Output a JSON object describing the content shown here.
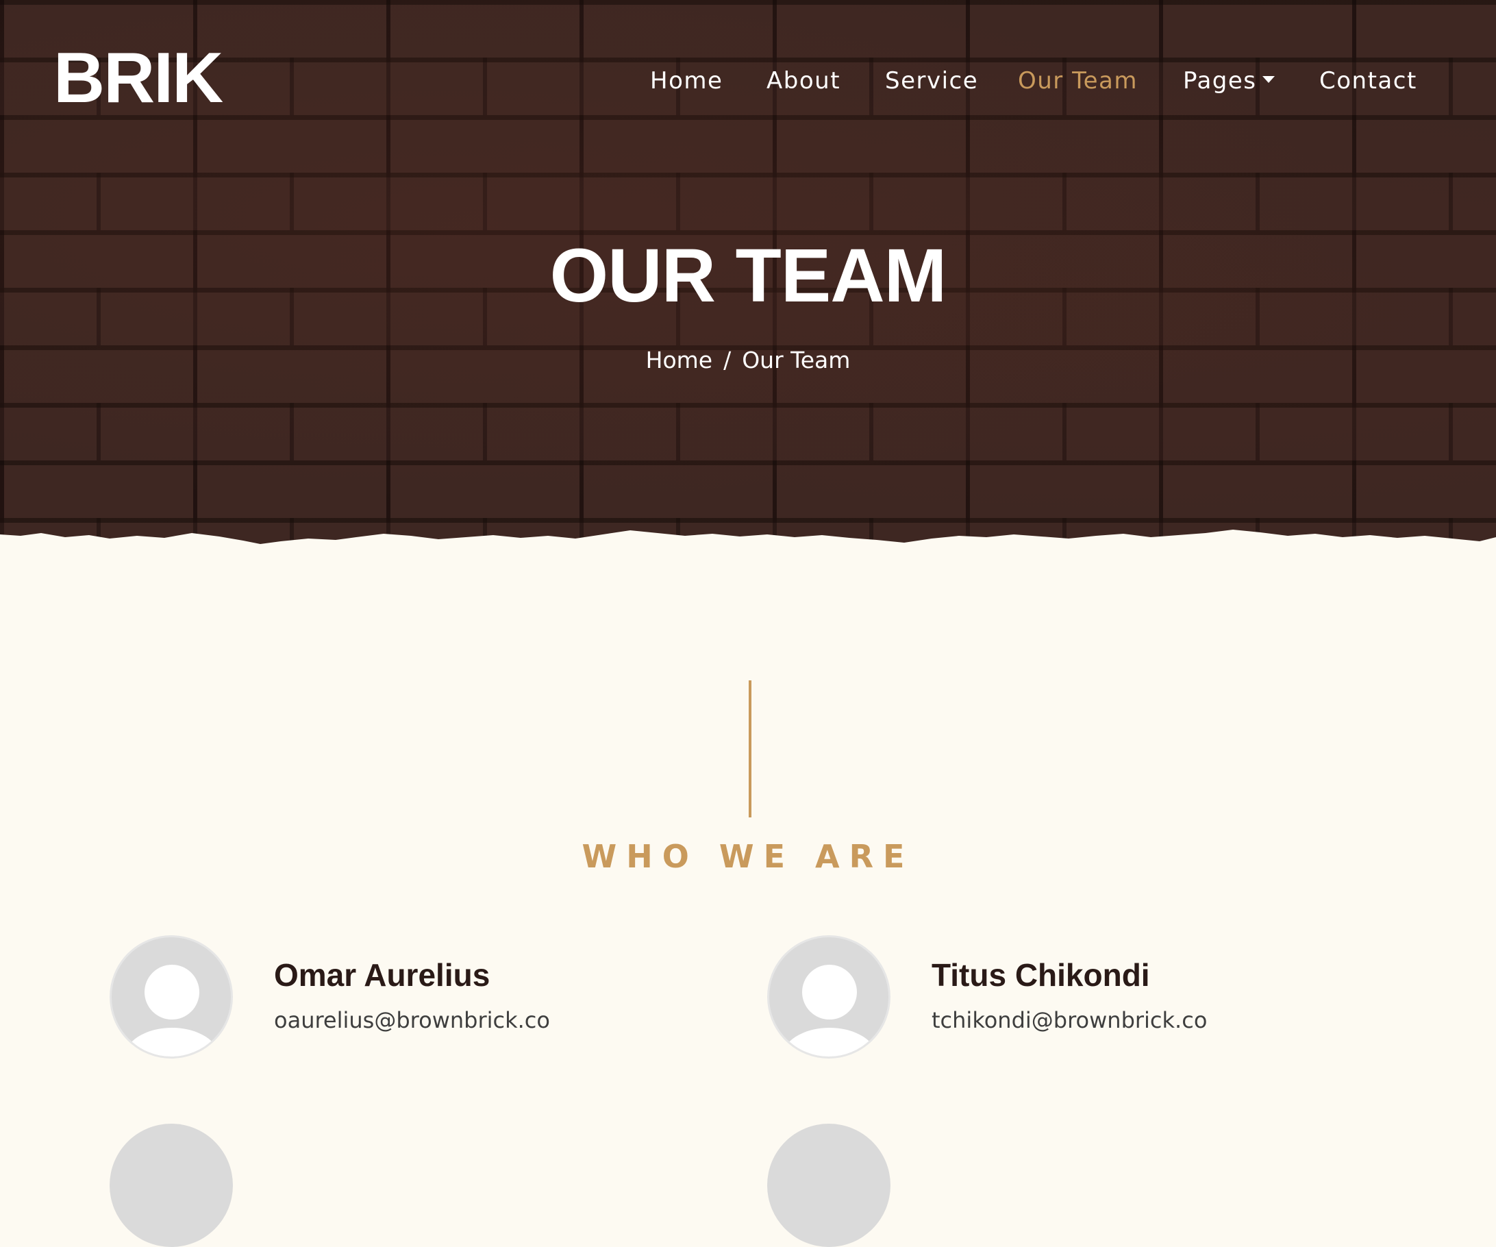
{
  "brand": {
    "logo": "BRIK"
  },
  "nav": {
    "items": [
      {
        "label": "Home"
      },
      {
        "label": "About"
      },
      {
        "label": "Service"
      },
      {
        "label": "Our Team"
      },
      {
        "label": "Pages"
      },
      {
        "label": "Contact"
      }
    ],
    "active": "Our Team"
  },
  "hero": {
    "title": "OUR TEAM",
    "breadcrumb": {
      "home": "Home",
      "separator": "/",
      "current": "Our Team"
    }
  },
  "section": {
    "label": "WHO WE ARE"
  },
  "team": [
    {
      "name": "Omar Aurelius",
      "email": "oaurelius@brownbrick.co"
    },
    {
      "name": "Titus Chikondi",
      "email": "tchikondi@brownbrick.co"
    }
  ],
  "colors": {
    "accent": "#c99a5c",
    "hero_bg": "#3e2722",
    "page_bg": "#fdfaf2",
    "text_dark": "#2a1a17"
  },
  "icons": {
    "pages_dropdown": "caret-down-icon",
    "avatar": "user-placeholder-icon"
  }
}
